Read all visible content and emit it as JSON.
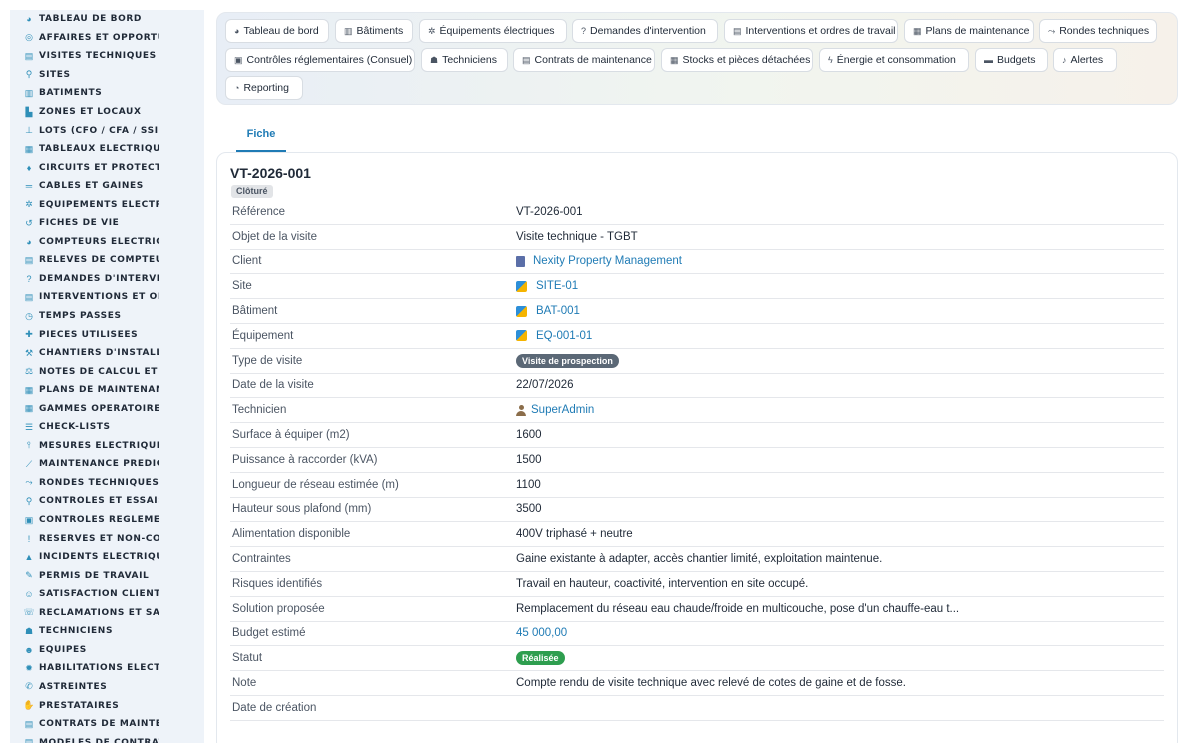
{
  "sidebar": {
    "items": [
      {
        "label": "TABLEAU DE BORD",
        "icon": "gauge-icon",
        "glyph": "◕"
      },
      {
        "label": "AFFAIRES ET OPPORTUNITÉS",
        "icon": "target-icon",
        "glyph": "◎"
      },
      {
        "label": "VISITES TECHNIQUES ET",
        "icon": "clipboard-icon",
        "glyph": "▤"
      },
      {
        "label": "SITES",
        "icon": "map-pin-icon",
        "glyph": "⚲"
      },
      {
        "label": "BÂTIMENTS",
        "icon": "building-icon",
        "glyph": "▥"
      },
      {
        "label": "ZONES ET LOCAUX",
        "icon": "door-icon",
        "glyph": "▙"
      },
      {
        "label": "LOTS (CFO / CFA / SSI...)",
        "icon": "sitemap-icon",
        "glyph": "⊥"
      },
      {
        "label": "TABLEAUX ÉLECTRIQUES",
        "icon": "grid-icon",
        "glyph": "▦"
      },
      {
        "label": "CIRCUITS ET PROTECTIONS",
        "icon": "plug-icon",
        "glyph": "♦"
      },
      {
        "label": "CÂBLES ET GAINES",
        "icon": "lines-icon",
        "glyph": "═"
      },
      {
        "label": "ÉQUIPEMENTS ÉLECTRIQUES",
        "icon": "cogs-icon",
        "glyph": "✲"
      },
      {
        "label": "FICHES DE VIE",
        "icon": "history-icon",
        "glyph": "↺"
      },
      {
        "label": "COMPTEURS ÉLECTRIQUES",
        "icon": "gauge-icon",
        "glyph": "◕"
      },
      {
        "label": "RELEVÉS DE COMPTEURS",
        "icon": "list-icon",
        "glyph": "▤"
      },
      {
        "label": "DEMANDES D'INTERVENTION",
        "icon": "question-icon",
        "glyph": "?"
      },
      {
        "label": "INTERVENTIONS ET ORDRES",
        "icon": "clipboard-list-icon",
        "glyph": "▤"
      },
      {
        "label": "TEMPS PASSÉS",
        "icon": "clock-icon",
        "glyph": "◷"
      },
      {
        "label": "PIÈCES UTILISÉES",
        "icon": "puzzle-icon",
        "glyph": "✚"
      },
      {
        "label": "CHANTIERS D'INSTALLATION",
        "icon": "hammer-icon",
        "glyph": "⚒"
      },
      {
        "label": "NOTES DE CALCUL ET ÉTUDES",
        "icon": "ruler-icon",
        "glyph": "⚖"
      },
      {
        "label": "PLANS DE MAINTENANCE",
        "icon": "calendar-icon",
        "glyph": "▦"
      },
      {
        "label": "GAMMES OPÉRATOIRES",
        "icon": "table-icon",
        "glyph": "▦"
      },
      {
        "label": "CHECK-LISTS",
        "icon": "checklist-icon",
        "glyph": "☰"
      },
      {
        "label": "MESURES ÉLECTRIQUES",
        "icon": "thermometer-icon",
        "glyph": "⫯"
      },
      {
        "label": "MAINTENANCE PRÉDICTIVE",
        "icon": "chart-line-icon",
        "glyph": "⟋"
      },
      {
        "label": "RONDES TECHNIQUES",
        "icon": "route-icon",
        "glyph": "⤳"
      },
      {
        "label": "CONTRÔLES ET ESSAIS",
        "icon": "search-icon",
        "glyph": "⚲"
      },
      {
        "label": "CONTRÔLES RÉGLEMENTAIRES",
        "icon": "clipboard-check-icon",
        "glyph": "▣"
      },
      {
        "label": "RÉSERVES ET NON-CONFORMITÉS",
        "icon": "exclamation-icon",
        "glyph": "!"
      },
      {
        "label": "INCIDENTS ÉLECTRIQUES",
        "icon": "warning-icon",
        "glyph": "▲"
      },
      {
        "label": "PERMIS DE TRAVAIL",
        "icon": "file-signature-icon",
        "glyph": "✎"
      },
      {
        "label": "SATISFACTION CLIENT",
        "icon": "smile-icon",
        "glyph": "☺"
      },
      {
        "label": "RÉCLAMATIONS ET SAV",
        "icon": "headset-icon",
        "glyph": "☏"
      },
      {
        "label": "TECHNICIENS",
        "icon": "hard-hat-icon",
        "glyph": "☗"
      },
      {
        "label": "ÉQUIPES",
        "icon": "users-icon",
        "glyph": "☻"
      },
      {
        "label": "HABILITATIONS ÉLECTRIQUES",
        "icon": "certificate-icon",
        "glyph": "✹"
      },
      {
        "label": "ASTREINTES",
        "icon": "phone-icon",
        "glyph": "✆"
      },
      {
        "label": "PRESTATAIRES",
        "icon": "handshake-icon",
        "glyph": "✋"
      },
      {
        "label": "CONTRATS DE MAINTENANCE",
        "icon": "file-contract-icon",
        "glyph": "▤"
      },
      {
        "label": "MODÈLES DE CONTRATS",
        "icon": "file-icon",
        "glyph": "▤"
      }
    ]
  },
  "topnav": {
    "pills": [
      {
        "label": "Tableau de bord",
        "icon": "gauge-icon",
        "glyph": "◕"
      },
      {
        "label": "Bâtiments",
        "icon": "building-icon",
        "glyph": "▥"
      },
      {
        "label": "Équipements électriques",
        "icon": "cogs-icon",
        "glyph": "✲"
      },
      {
        "label": "Demandes d'intervention",
        "icon": "question-icon",
        "glyph": "?"
      },
      {
        "label": "Interventions et ordres de travail",
        "icon": "clipboard-icon",
        "glyph": "▤"
      },
      {
        "label": "Plans de maintenance",
        "icon": "calendar-icon",
        "glyph": "▦"
      },
      {
        "label": "Rondes techniques",
        "icon": "route-icon",
        "glyph": "⤳"
      },
      {
        "label": "Contrôles réglementaires (Consuel)",
        "icon": "clipboard-check-icon",
        "glyph": "▣"
      },
      {
        "label": "Techniciens",
        "icon": "hard-hat-icon",
        "glyph": "☗"
      },
      {
        "label": "Contrats de maintenance",
        "icon": "file-contract-icon",
        "glyph": "▤"
      },
      {
        "label": "Stocks et pièces détachées",
        "icon": "boxes-icon",
        "glyph": "▦"
      },
      {
        "label": "Énergie et consommation",
        "icon": "bolt-icon",
        "glyph": "ϟ"
      },
      {
        "label": "Budgets",
        "icon": "money-icon",
        "glyph": "▬"
      },
      {
        "label": "Alertes",
        "icon": "bell-icon",
        "glyph": "♪"
      },
      {
        "label": "Reporting",
        "icon": "chart-pie-icon",
        "glyph": "◔"
      }
    ]
  },
  "tabs": {
    "fiche": "Fiche"
  },
  "record": {
    "title": "VT-2026-001",
    "status_badge": "Clôturé",
    "fields": [
      {
        "label": "Référence",
        "value": "VT-2026-001",
        "kind": "text"
      },
      {
        "label": "Objet de la visite",
        "value": "Visite technique - TGBT",
        "kind": "text"
      },
      {
        "label": "Client",
        "value": "Nexity Property Management",
        "kind": "link-building"
      },
      {
        "label": "Site",
        "value": "SITE-01",
        "kind": "link-site"
      },
      {
        "label": "Bâtiment",
        "value": "BAT-001",
        "kind": "link-site"
      },
      {
        "label": "Équipement",
        "value": "EQ-001-01",
        "kind": "link-site"
      },
      {
        "label": "Type de visite",
        "value": "Visite de prospection",
        "kind": "tag",
        "color": "#5b6876"
      },
      {
        "label": "Date de la visite",
        "value": "22/07/2026",
        "kind": "text"
      },
      {
        "label": "Technicien",
        "value": "SuperAdmin",
        "kind": "link-user"
      },
      {
        "label": "Surface à équiper (m2)",
        "value": "1600",
        "kind": "text"
      },
      {
        "label": "Puissance à raccorder (kVA)",
        "value": "1500",
        "kind": "text"
      },
      {
        "label": "Longueur de réseau estimée (m)",
        "value": "1100",
        "kind": "text"
      },
      {
        "label": "Hauteur sous plafond (mm)",
        "value": "3500",
        "kind": "text"
      },
      {
        "label": "Alimentation disponible",
        "value": "400V triphasé + neutre",
        "kind": "text"
      },
      {
        "label": "Contraintes",
        "value": "Gaine existante à adapter, accès chantier limité, exploitation maintenue.",
        "kind": "text"
      },
      {
        "label": "Risques identifiés",
        "value": "Travail en hauteur, coactivité, intervention en site occupé.",
        "kind": "text"
      },
      {
        "label": "Solution proposée",
        "value": "Remplacement du réseau eau chaude/froide en multicouche, pose d'un chauffe-eau t...",
        "kind": "text"
      },
      {
        "label": "Budget estimé",
        "value": "45 000,00",
        "kind": "link-plain"
      },
      {
        "label": "Statut",
        "value": "Réalisée",
        "kind": "tag",
        "color": "#2e9e4f"
      },
      {
        "label": "Note",
        "value": "Compte rendu de visite technique avec relevé de cotes de gaine et de fosse.",
        "kind": "text"
      },
      {
        "label": "Date de création",
        "value": "",
        "kind": "text"
      }
    ]
  }
}
